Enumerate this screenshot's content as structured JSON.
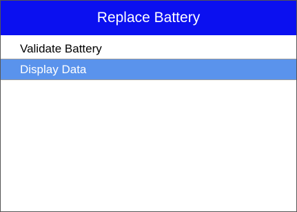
{
  "header": {
    "title": "Replace Battery"
  },
  "menu": {
    "items": [
      {
        "label": "Validate Battery",
        "selected": false
      },
      {
        "label": "Display Data",
        "selected": true
      }
    ]
  },
  "colors": {
    "title_bar": "#0b10f0",
    "selected_row": "#5a93ec",
    "text": "#000000",
    "selected_text": "#ffffff"
  }
}
